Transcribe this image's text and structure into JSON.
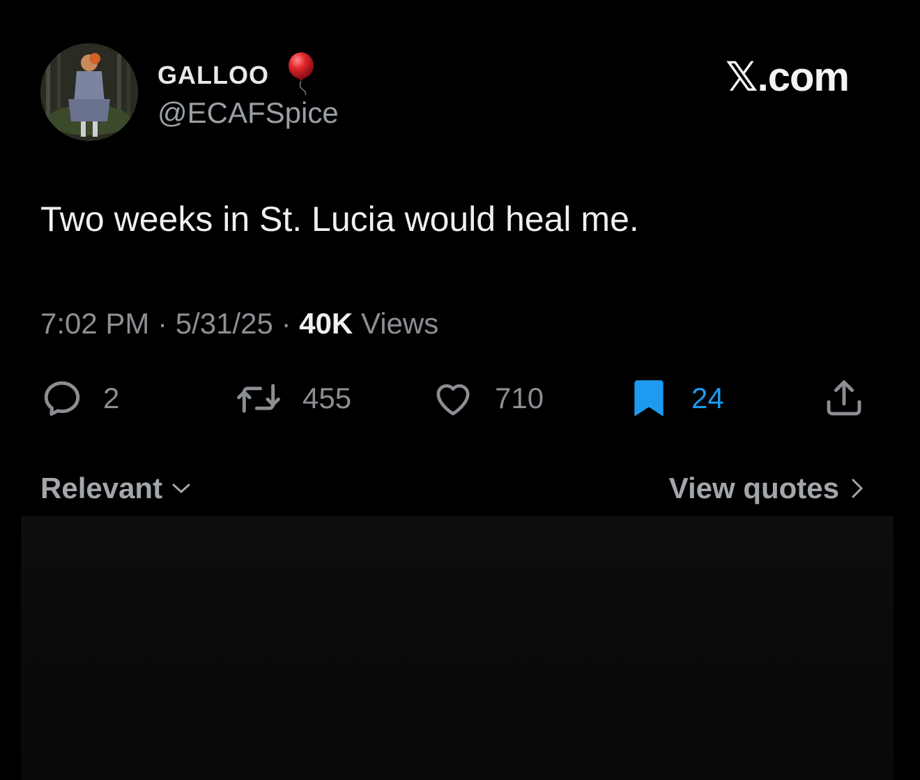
{
  "author": {
    "display_name": "GALLOO",
    "badge_emoji": "balloon-icon",
    "handle": "@ECAFSpice"
  },
  "brand": "𝕏.com",
  "tweet": {
    "text": "Two weeks in St. Lucia would heal me.",
    "time": "7:02 PM",
    "date": "5/31/25",
    "views_count": "40K",
    "views_label": "Views"
  },
  "actions": {
    "replies": "2",
    "reposts": "455",
    "likes": "710",
    "bookmarks": "24"
  },
  "footer": {
    "sort_label": "Relevant",
    "quotes_label": "View quotes"
  },
  "colors": {
    "background": "#000000",
    "accent": "#1d9bf0",
    "muted": "#8b8f94",
    "balloon": "#e0262c"
  }
}
